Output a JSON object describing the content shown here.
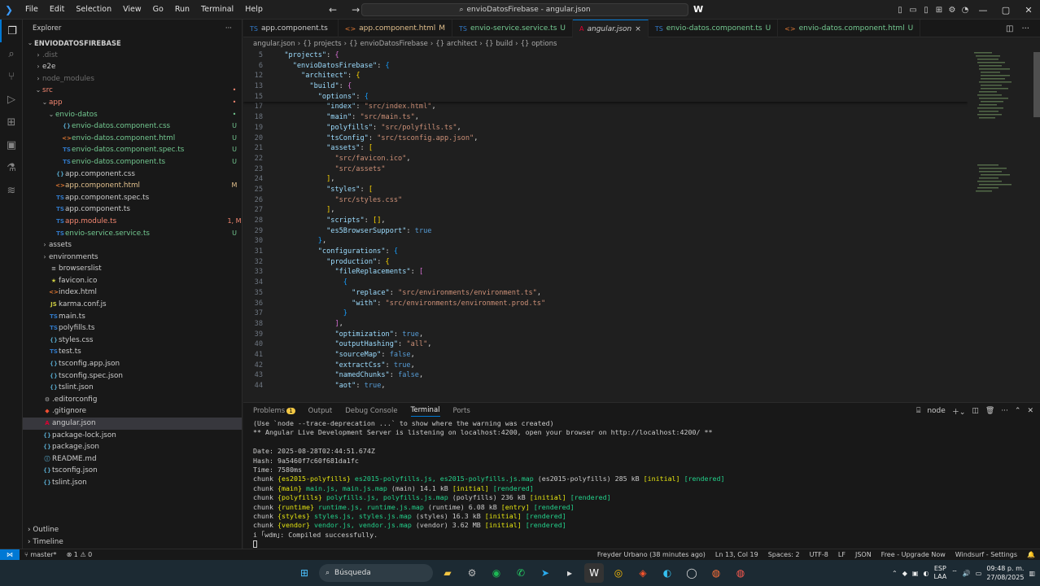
{
  "titlebar": {
    "menu": [
      "File",
      "Edit",
      "Selection",
      "View",
      "Go",
      "Run",
      "Terminal",
      "Help"
    ],
    "search_text": "envioDatosFirebase - angular.json"
  },
  "sidebar": {
    "title": "Explorer",
    "root": "ENVIODATOSFIREBASE",
    "items": [
      {
        "indent": 0,
        "chev": "›",
        "icon": "",
        "name": ".dist",
        "badge": "",
        "color": "gray"
      },
      {
        "indent": 0,
        "chev": "›",
        "icon": "",
        "name": "e2e",
        "badge": "",
        "color": "white"
      },
      {
        "indent": 0,
        "chev": "›",
        "icon": "",
        "name": "node_modules",
        "badge": "",
        "color": "gray"
      },
      {
        "indent": 0,
        "chev": "⌄",
        "icon": "",
        "name": "src",
        "badge": "•",
        "color": "red"
      },
      {
        "indent": 1,
        "chev": "⌄",
        "icon": "",
        "name": "app",
        "badge": "•",
        "color": "red"
      },
      {
        "indent": 2,
        "chev": "⌄",
        "icon": "",
        "name": "envio-datos",
        "badge": "•",
        "color": "green"
      },
      {
        "indent": 3,
        "chev": "",
        "icon": "{}",
        "name": "envio-datos.component.css",
        "badge": "U",
        "color": "green"
      },
      {
        "indent": 3,
        "chev": "",
        "icon": "<>",
        "name": "envio-datos.component.html",
        "badge": "U",
        "color": "green"
      },
      {
        "indent": 3,
        "chev": "",
        "icon": "TS",
        "name": "envio-datos.component.spec.ts",
        "badge": "U",
        "color": "green"
      },
      {
        "indent": 3,
        "chev": "",
        "icon": "TS",
        "name": "envio-datos.component.ts",
        "badge": "U",
        "color": "green"
      },
      {
        "indent": 2,
        "chev": "",
        "icon": "{}",
        "name": "app.component.css",
        "badge": "",
        "color": "white"
      },
      {
        "indent": 2,
        "chev": "",
        "icon": "<>",
        "name": "app.component.html",
        "badge": "M",
        "color": "orange"
      },
      {
        "indent": 2,
        "chev": "",
        "icon": "TS",
        "name": "app.component.spec.ts",
        "badge": "",
        "color": "white"
      },
      {
        "indent": 2,
        "chev": "",
        "icon": "TS",
        "name": "app.component.ts",
        "badge": "",
        "color": "white"
      },
      {
        "indent": 2,
        "chev": "",
        "icon": "TS",
        "name": "app.module.ts",
        "badge": "1, M",
        "color": "red"
      },
      {
        "indent": 2,
        "chev": "",
        "icon": "TS",
        "name": "envio-service.service.ts",
        "badge": "U",
        "color": "green"
      },
      {
        "indent": 1,
        "chev": "›",
        "icon": "",
        "name": "assets",
        "badge": "",
        "color": "white"
      },
      {
        "indent": 1,
        "chev": "›",
        "icon": "",
        "name": "environments",
        "badge": "",
        "color": "white"
      },
      {
        "indent": 1,
        "chev": "",
        "icon": "≡",
        "name": "browserslist",
        "badge": "",
        "color": "white"
      },
      {
        "indent": 1,
        "chev": "",
        "icon": "★",
        "name": "favicon.ico",
        "badge": "",
        "color": "white"
      },
      {
        "indent": 1,
        "chev": "",
        "icon": "<>",
        "name": "index.html",
        "badge": "",
        "color": "white"
      },
      {
        "indent": 1,
        "chev": "",
        "icon": "JS",
        "name": "karma.conf.js",
        "badge": "",
        "color": "white"
      },
      {
        "indent": 1,
        "chev": "",
        "icon": "TS",
        "name": "main.ts",
        "badge": "",
        "color": "white"
      },
      {
        "indent": 1,
        "chev": "",
        "icon": "TS",
        "name": "polyfills.ts",
        "badge": "",
        "color": "white"
      },
      {
        "indent": 1,
        "chev": "",
        "icon": "{}",
        "name": "styles.css",
        "badge": "",
        "color": "white"
      },
      {
        "indent": 1,
        "chev": "",
        "icon": "TS",
        "name": "test.ts",
        "badge": "",
        "color": "white"
      },
      {
        "indent": 1,
        "chev": "",
        "icon": "{}",
        "name": "tsconfig.app.json",
        "badge": "",
        "color": "white"
      },
      {
        "indent": 1,
        "chev": "",
        "icon": "{}",
        "name": "tsconfig.spec.json",
        "badge": "",
        "color": "white"
      },
      {
        "indent": 1,
        "chev": "",
        "icon": "{}",
        "name": "tslint.json",
        "badge": "",
        "color": "white"
      },
      {
        "indent": 0,
        "chev": "",
        "icon": "⚙",
        "name": ".editorconfig",
        "badge": "",
        "color": "white"
      },
      {
        "indent": 0,
        "chev": "",
        "icon": "◆",
        "name": ".gitignore",
        "badge": "",
        "color": "white"
      },
      {
        "indent": 0,
        "chev": "",
        "icon": "A",
        "name": "angular.json",
        "badge": "",
        "color": "white",
        "selected": true
      },
      {
        "indent": 0,
        "chev": "",
        "icon": "{}",
        "name": "package-lock.json",
        "badge": "",
        "color": "white"
      },
      {
        "indent": 0,
        "chev": "",
        "icon": "{}",
        "name": "package.json",
        "badge": "",
        "color": "white"
      },
      {
        "indent": 0,
        "chev": "",
        "icon": "ⓘ",
        "name": "README.md",
        "badge": "",
        "color": "white"
      },
      {
        "indent": 0,
        "chev": "",
        "icon": "{}",
        "name": "tsconfig.json",
        "badge": "",
        "color": "white"
      },
      {
        "indent": 0,
        "chev": "",
        "icon": "{}",
        "name": "tslint.json",
        "badge": "",
        "color": "white"
      }
    ],
    "outline": "Outline",
    "timeline": "Timeline"
  },
  "tabs": [
    {
      "icon": "TS",
      "label": "app.component.ts",
      "suffix": "",
      "color": "white",
      "active": false
    },
    {
      "icon": "<>",
      "label": "app.component.html",
      "suffix": "M",
      "color": "orange",
      "active": false
    },
    {
      "icon": "TS",
      "label": "envio-service.service.ts",
      "suffix": "U",
      "color": "green",
      "active": false
    },
    {
      "icon": "A",
      "label": "angular.json",
      "suffix": "×",
      "color": "white",
      "active": true
    },
    {
      "icon": "TS",
      "label": "envio-datos.component.ts",
      "suffix": "U",
      "color": "green",
      "active": false
    },
    {
      "icon": "<>",
      "label": "envio-datos.component.html",
      "suffix": "U",
      "color": "green",
      "active": false
    }
  ],
  "breadcrumb": [
    "angular.json",
    "{} projects",
    "{} envioDatosFirebase",
    "{} architect",
    "{} build",
    "{} options"
  ],
  "editor": {
    "sticky": [
      {
        "n": "5",
        "html": "  <span class='k'>\"projects\"</span>: <span class='p2'>{</span>"
      },
      {
        "n": "6",
        "html": "    <span class='k'>\"envioDatosFirebase\"</span>: <span class='p3'>{</span>"
      },
      {
        "n": "12",
        "html": "      <span class='k'>\"architect\"</span>: <span class='p1'>{</span>"
      },
      {
        "n": "13",
        "html": "        <span class='k'>\"build\"</span>: <span class='p2'>{</span>"
      },
      {
        "n": "15",
        "html": "          <span class='k'>\"options\"</span>: <span class='p3'>{</span>"
      }
    ],
    "lines": [
      {
        "n": "17",
        "html": "            <span class='k'>\"index\"</span>: <span class='s'>\"src/index.html\"</span>,"
      },
      {
        "n": "18",
        "html": "            <span class='k'>\"main\"</span>: <span class='s'>\"src/main.ts\"</span>,"
      },
      {
        "n": "19",
        "html": "            <span class='k'>\"polyfills\"</span>: <span class='s'>\"src/polyfills.ts\"</span>,"
      },
      {
        "n": "20",
        "html": "            <span class='k'>\"tsConfig\"</span>: <span class='s'>\"src/tsconfig.app.json\"</span>,"
      },
      {
        "n": "21",
        "html": "            <span class='k'>\"assets\"</span>: <span class='p1'>[</span>"
      },
      {
        "n": "22",
        "html": "              <span class='s'>\"src/favicon.ico\"</span>,"
      },
      {
        "n": "23",
        "html": "              <span class='s'>\"src/assets\"</span>"
      },
      {
        "n": "24",
        "html": "            <span class='p1'>]</span>,"
      },
      {
        "n": "25",
        "html": "            <span class='k'>\"styles\"</span>: <span class='p1'>[</span>"
      },
      {
        "n": "26",
        "html": "              <span class='s'>\"src/styles.css\"</span>"
      },
      {
        "n": "27",
        "html": "            <span class='p1'>]</span>,"
      },
      {
        "n": "28",
        "html": "            <span class='k'>\"scripts\"</span>: <span class='p1'>[]</span>,"
      },
      {
        "n": "29",
        "html": "            <span class='k'>\"es5BrowserSupport\"</span>: <span class='b'>true</span>"
      },
      {
        "n": "30",
        "html": "          <span class='p3'>}</span>,"
      },
      {
        "n": "31",
        "html": "          <span class='k'>\"configurations\"</span>: <span class='p3'>{</span>"
      },
      {
        "n": "32",
        "html": "            <span class='k'>\"production\"</span>: <span class='p1'>{</span>"
      },
      {
        "n": "33",
        "html": "              <span class='k'>\"fileReplacements\"</span>: <span class='p2'>[</span>"
      },
      {
        "n": "34",
        "html": "                <span class='p3'>{</span>"
      },
      {
        "n": "35",
        "html": "                  <span class='k'>\"replace\"</span>: <span class='s'>\"src/environments/environment.ts\"</span>,"
      },
      {
        "n": "36",
        "html": "                  <span class='k'>\"with\"</span>: <span class='s'>\"src/environments/environment.prod.ts\"</span>"
      },
      {
        "n": "37",
        "html": "                <span class='p3'>}</span>"
      },
      {
        "n": "38",
        "html": "              <span class='p2'>]</span>,"
      },
      {
        "n": "39",
        "html": "              <span class='k'>\"optimization\"</span>: <span class='b'>true</span>,"
      },
      {
        "n": "40",
        "html": "              <span class='k'>\"outputHashing\"</span>: <span class='s'>\"all\"</span>,"
      },
      {
        "n": "41",
        "html": "              <span class='k'>\"sourceMap\"</span>: <span class='b'>false</span>,"
      },
      {
        "n": "42",
        "html": "              <span class='k'>\"extractCss\"</span>: <span class='b'>true</span>,"
      },
      {
        "n": "43",
        "html": "              <span class='k'>\"namedChunks\"</span>: <span class='b'>false</span>,"
      },
      {
        "n": "44",
        "html": "              <span class='k'>\"aot\"</span>: <span class='b'>true</span>,"
      }
    ]
  },
  "panel": {
    "tabs": [
      "Problems",
      "Output",
      "Debug Console",
      "Terminal",
      "Ports"
    ],
    "problems_count": "1",
    "active_tab": "Terminal",
    "terminal_name": "node",
    "lines": [
      "(Use `node --trace-deprecation ...` to show where the warning was created)",
      "** Angular Live Development Server is listening on localhost:4200, open your browser on http://localhost:4200/ **",
      "",
      "Date: 2025-08-28T02:44:51.674Z",
      "Hash: 9a5460f7c60f681da1fc",
      "Time: 7580ms"
    ],
    "chunks": [
      {
        "name": "{es2015-polyfills}",
        "files": "es2015-polyfills.js, es2015-polyfills.js.map",
        "info": "(es2015-polyfills) 285 kB",
        "tag": "[initial]"
      },
      {
        "name": "{main}",
        "files": "main.js, main.js.map",
        "info": "(main) 14.1 kB",
        "tag": "[initial]"
      },
      {
        "name": "{polyfills}",
        "files": "polyfills.js, polyfills.js.map",
        "info": "(polyfills) 236 kB",
        "tag": "[initial]"
      },
      {
        "name": "{runtime}",
        "files": "runtime.js, runtime.js.map",
        "info": "(runtime) 6.08 kB",
        "tag": "[entry]"
      },
      {
        "name": "{styles}",
        "files": "styles.js, styles.js.map",
        "info": "(styles) 16.3 kB",
        "tag": "[initial]"
      },
      {
        "name": "{vendor}",
        "files": "vendor.js, vendor.js.map",
        "info": "(vendor) 3.62 MB",
        "tag": "[initial]"
      }
    ],
    "rendered": "[rendered]",
    "compiled": "i ｢wdm｣: Compiled successfully."
  },
  "statusbar": {
    "branch": "master*",
    "sync": "⊗ 1 ⚠ 0",
    "author": "Freyder Urbano (38 minutes ago)",
    "position": "Ln 13, Col 19",
    "spaces": "Spaces: 2",
    "encoding": "UTF-8",
    "eol": "LF",
    "language": "JSON",
    "upgrade": "Free - Upgrade Now",
    "windsurf": "Windsurf - Settings"
  },
  "taskbar": {
    "search": "Búsqueda",
    "lang": "ESP",
    "lang2": "LAA",
    "time": "09:48 p. m.",
    "date": "27/08/2025"
  }
}
